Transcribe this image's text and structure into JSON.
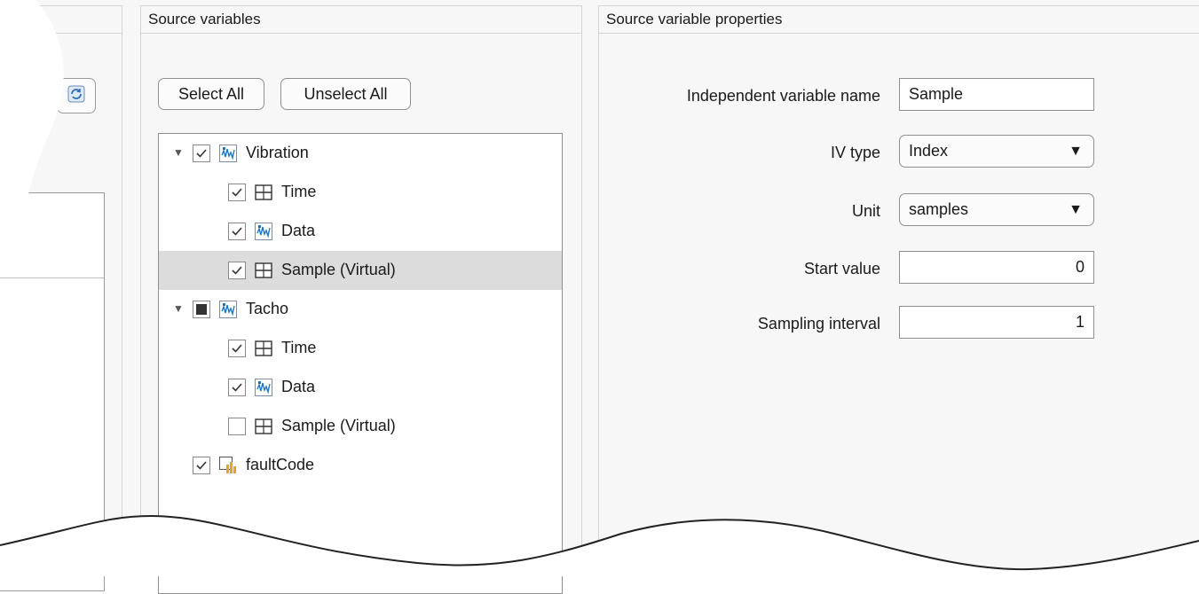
{
  "panels": {
    "source_variables_title": "Source variables",
    "properties_title": "Source variable properties"
  },
  "buttons": {
    "select_all": "Select All",
    "unselect_all": "Unselect All"
  },
  "tree": {
    "items": [
      {
        "label": "Vibration",
        "level": 0,
        "checked": true,
        "expanded": true,
        "icon": "signal-icon"
      },
      {
        "label": "Time",
        "level": 1,
        "checked": true,
        "icon": "table-icon"
      },
      {
        "label": "Data",
        "level": 1,
        "checked": true,
        "icon": "signal-icon"
      },
      {
        "label": "Sample (Virtual)",
        "level": 1,
        "checked": true,
        "icon": "table-icon",
        "selected": true
      },
      {
        "label": "Tacho",
        "level": 0,
        "checked": "partial",
        "expanded": true,
        "icon": "signal-icon"
      },
      {
        "label": "Time",
        "level": 1,
        "checked": true,
        "icon": "table-icon"
      },
      {
        "label": "Data",
        "level": 1,
        "checked": true,
        "icon": "signal-icon"
      },
      {
        "label": "Sample (Virtual)",
        "level": 1,
        "checked": false,
        "icon": "table-icon"
      },
      {
        "label": "faultCode",
        "level": 0,
        "checked": true,
        "icon": "categorical-icon"
      }
    ]
  },
  "properties": {
    "independent_variable_name_label": "Independent variable name",
    "independent_variable_name_value": "Sample",
    "iv_type_label": "IV type",
    "iv_type_value": "Index",
    "unit_label": "Unit",
    "unit_value": "samples",
    "start_value_label": "Start value",
    "start_value_value": "0",
    "sampling_interval_label": "Sampling interval",
    "sampling_interval_value": "1"
  },
  "colors": {
    "selected_row": "#dcdcdc",
    "icon_blue": "#1f77c4",
    "icon_orange": "#e0a52a"
  }
}
